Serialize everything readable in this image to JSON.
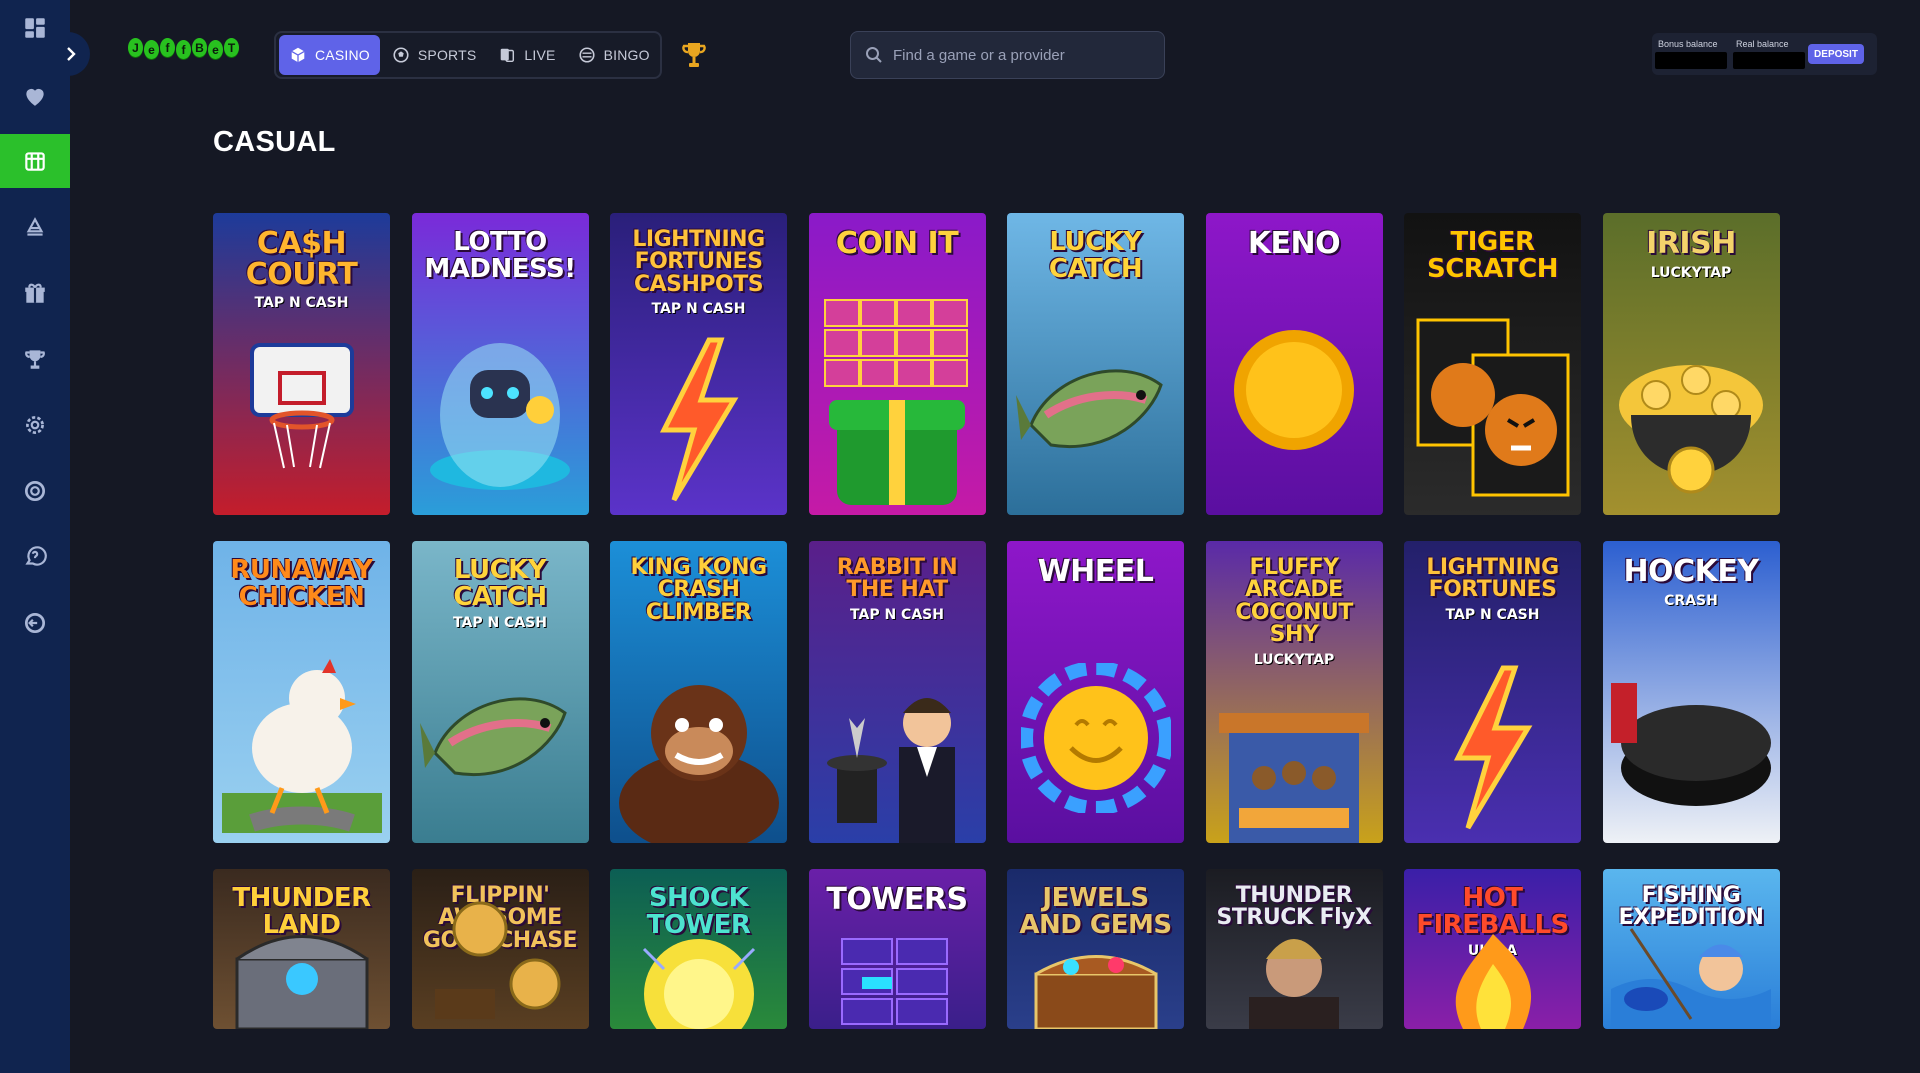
{
  "app": {
    "logo_letters": [
      "J",
      "e",
      "f",
      "f",
      "B",
      "e",
      "T"
    ]
  },
  "sidebar": {
    "items": [
      {
        "name": "grid-icon"
      },
      {
        "name": "heart-icon"
      },
      {
        "name": "casino-chip-icon",
        "active": true
      },
      {
        "name": "sports-icon"
      },
      {
        "name": "gift-icon"
      },
      {
        "name": "trophy-icon"
      },
      {
        "name": "settings-icon"
      },
      {
        "name": "support-icon"
      },
      {
        "name": "help-icon"
      },
      {
        "name": "logout-icon"
      }
    ]
  },
  "nav": {
    "tabs": [
      {
        "label": "CASINO",
        "icon": "cube-icon",
        "active": true
      },
      {
        "label": "SPORTS",
        "icon": "ball-icon"
      },
      {
        "label": "LIVE",
        "icon": "cards-icon"
      },
      {
        "label": "BINGO",
        "icon": "bingo-icon"
      }
    ],
    "trophy_icon": "trophy-icon"
  },
  "search": {
    "placeholder": "Find a game or a provider"
  },
  "balance": {
    "bonus_label": "Bonus balance",
    "real_label": "Real balance",
    "deposit_label": "DEPOSIT"
  },
  "page": {
    "title": "CASUAL"
  },
  "games": [
    {
      "title": "CA$H COURT",
      "subtitle": "TAP N CASH",
      "bg": "#1d3b9a",
      "bg2": "#c41d2b",
      "color": "#ffb52e",
      "art": "hoop"
    },
    {
      "title": "LOTTO MADNESS!",
      "subtitle": "",
      "bg": "#7a2ad9",
      "bg2": "#2a9ed9",
      "color": "#ffffff",
      "art": "robot"
    },
    {
      "title": "LIGHTNING FORTUNES CASHPOTS",
      "subtitle": "TAP N CASH",
      "bg": "#2a1f7a",
      "bg2": "#5b33c9",
      "color": "#ffc23b",
      "art": "bolt"
    },
    {
      "title": "COIN IT",
      "subtitle": "",
      "bg": "#8a1ac9",
      "bg2": "#c51aa6",
      "color": "#ffd23d",
      "art": "gift"
    },
    {
      "title": "LUCKY CATCH",
      "subtitle": "",
      "bg": "#6fb7e6",
      "bg2": "#2c6f9a",
      "color": "#ffd43b",
      "art": "fish"
    },
    {
      "title": "KENO",
      "subtitle": "",
      "bg": "#8e17c9",
      "bg2": "#5a0fa0",
      "color": "#ffffff",
      "art": "coin"
    },
    {
      "title": "TIGER SCRATCH",
      "subtitle": "",
      "bg": "#121212",
      "bg2": "#2b2b2b",
      "color": "#ffc400",
      "art": "tiger"
    },
    {
      "title": "IRISH",
      "subtitle": "LUCKYTAP",
      "bg": "#5b6e2a",
      "bg2": "#a3902e",
      "color": "#f4d36b",
      "art": "pot"
    },
    {
      "title": "RUNAWAY CHICKEN",
      "subtitle": "",
      "bg": "#6fb3e8",
      "bg2": "#9ad0f0",
      "color": "#ff8a1a",
      "art": "chicken"
    },
    {
      "title": "LUCKY CATCH",
      "subtitle": "TAP N CASH",
      "bg": "#7ab6c9",
      "bg2": "#3a7d90",
      "color": "#ffd43b",
      "art": "fish"
    },
    {
      "title": "KING KONG CRASH CLIMBER",
      "subtitle": "",
      "bg": "#1c8fd8",
      "bg2": "#0e4f8c",
      "color": "#ffcf3a",
      "art": "kong"
    },
    {
      "title": "RABBIT IN THE HAT",
      "subtitle": "TAP N CASH",
      "bg": "#5a1f8a",
      "bg2": "#2a3fa8",
      "color": "#ff9a2a",
      "art": "magician"
    },
    {
      "title": "WHEEL",
      "subtitle": "",
      "bg": "#8e17c9",
      "bg2": "#5a0fa0",
      "color": "#ffffff",
      "art": "smile"
    },
    {
      "title": "FLUFFY ARCADE COCONUT SHY",
      "subtitle": "LUCKYTAP",
      "bg": "#5a2aa8",
      "bg2": "#c9a21a",
      "color": "#ffd23d",
      "art": "stall"
    },
    {
      "title": "LIGHTNING FORTUNES",
      "subtitle": "TAP N CASH",
      "bg": "#23206a",
      "bg2": "#4a2fb0",
      "color": "#ffc23b",
      "art": "bolt"
    },
    {
      "title": "HOCKEY",
      "subtitle": "CRASH",
      "bg": "#2c5fd0",
      "bg2": "#eef1f6",
      "color": "#ffffff",
      "art": "puck"
    },
    {
      "title": "THUNDER LAND",
      "subtitle": "",
      "bg": "#3a2a1f",
      "bg2": "#6e5032",
      "color": "#ffcf3a",
      "art": "chest"
    },
    {
      "title": "FLIPPIN' AWESOME GOLD CHASE",
      "subtitle": "",
      "bg": "#2a1f16",
      "bg2": "#5a3f22",
      "color": "#f2c25b",
      "art": "coins"
    },
    {
      "title": "SHOCK TOWER",
      "subtitle": "",
      "bg": "#0c5e54",
      "bg2": "#2a8a3a",
      "color": "#4de3d0",
      "art": "orb"
    },
    {
      "title": "TOWERS",
      "subtitle": "",
      "bg": "#6a1fa8",
      "bg2": "#3a1f8a",
      "color": "#ffffff",
      "art": "blocks"
    },
    {
      "title": "JEWELS AND GEMS",
      "subtitle": "",
      "bg": "#1a2a6a",
      "bg2": "#2a3f8a",
      "color": "#e8c66a",
      "art": "treasure"
    },
    {
      "title": "THUNDER STRUCK FlyX",
      "subtitle": "",
      "bg": "#1b1c22",
      "bg2": "#3a3c48",
      "color": "#e9ecf2",
      "art": "viking"
    },
    {
      "title": "HOT FIREBALLS",
      "subtitle": "ULTRA",
      "bg": "#3a1fa8",
      "bg2": "#8a1fa8",
      "color": "#ff4a2a",
      "art": "flame"
    },
    {
      "title": "FISHING EXPEDITION",
      "subtitle": "",
      "bg": "#5ab6ee",
      "bg2": "#2a7ed8",
      "color": "#ffffff",
      "art": "fisher"
    }
  ]
}
